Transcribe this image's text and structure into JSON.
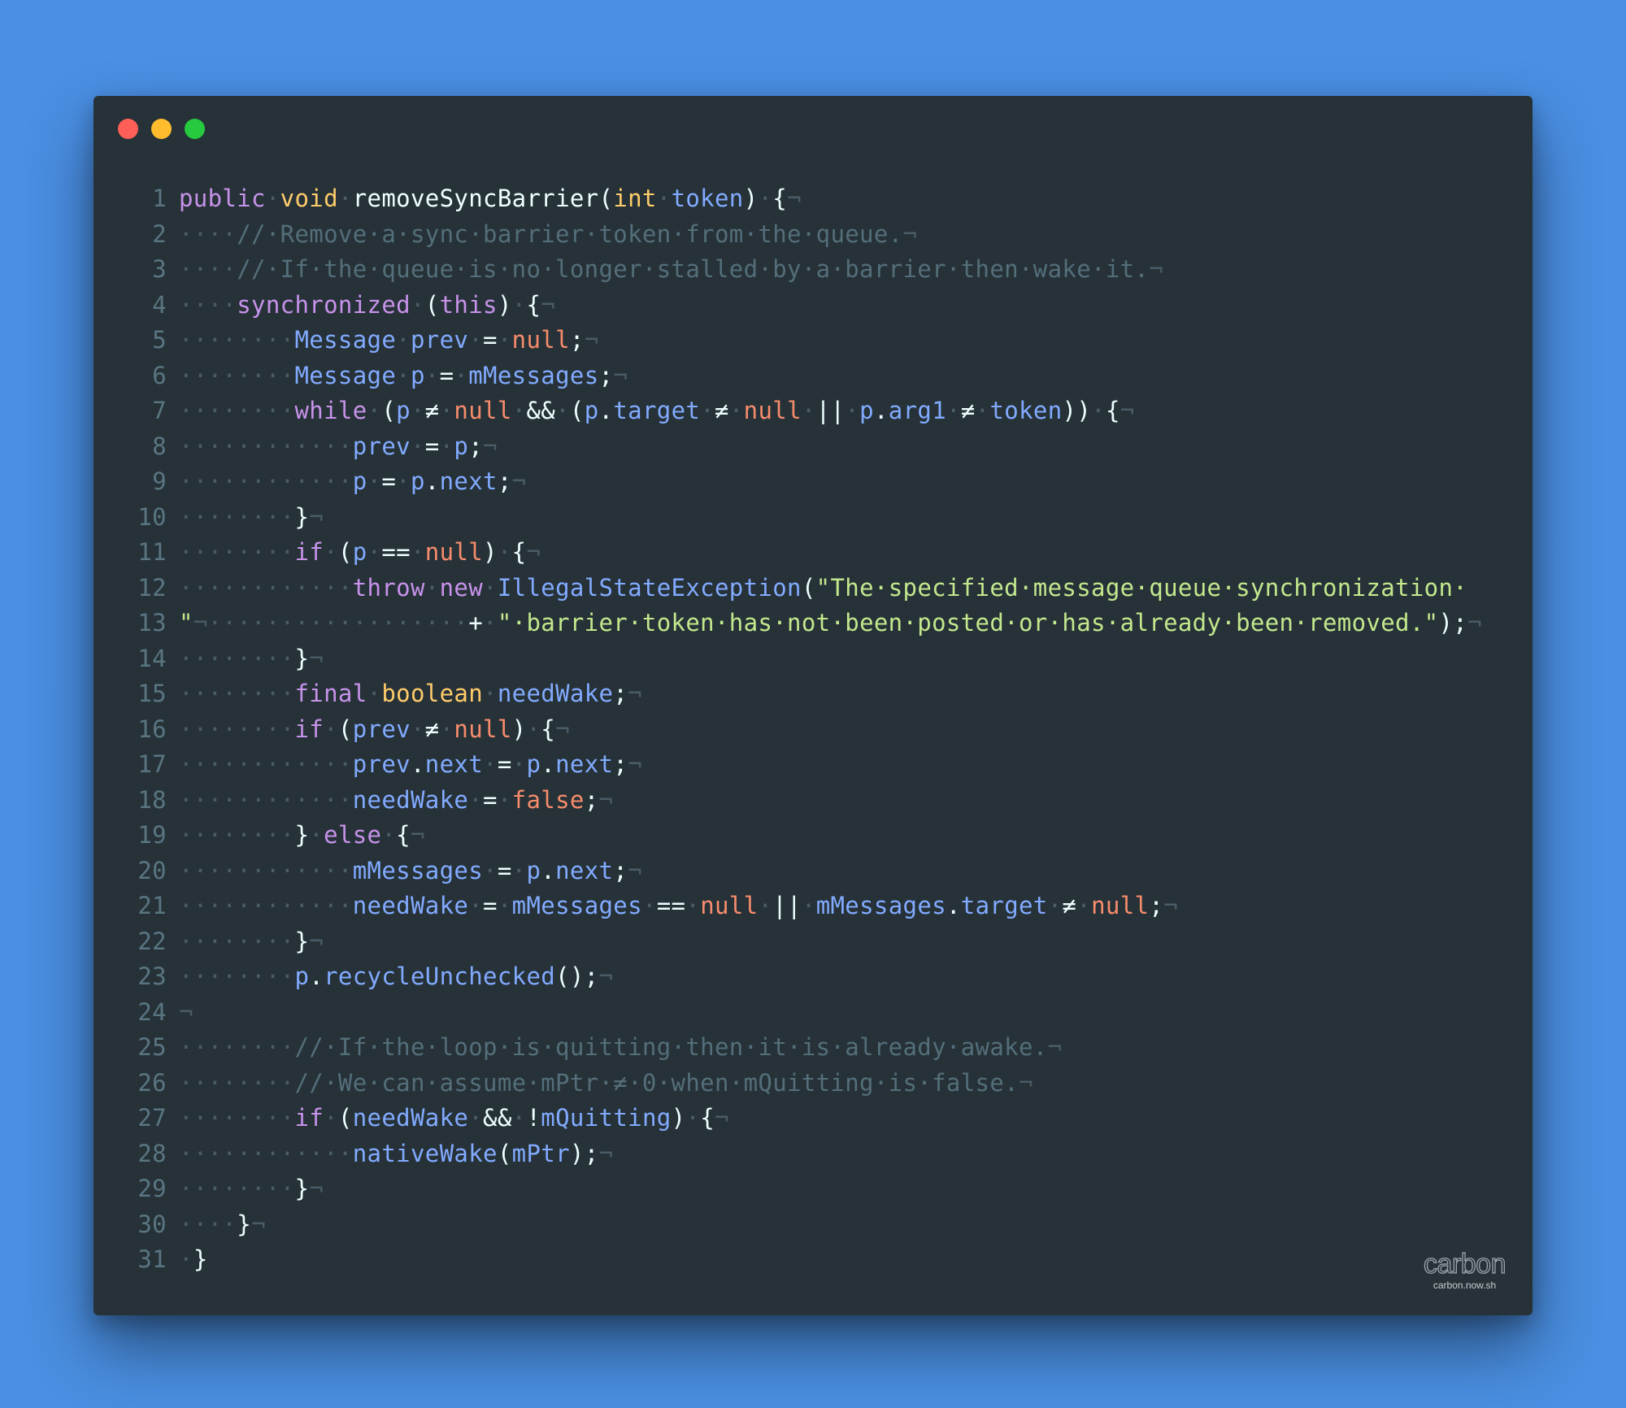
{
  "window": {
    "controls": [
      "close",
      "minimize",
      "maximize"
    ],
    "colors": {
      "background_outer": "#4a90e2",
      "editor_background": "#263238",
      "close": "#ff5f56",
      "minimize": "#ffbd2e",
      "maximize": "#27c93f"
    }
  },
  "watermark": {
    "word": "carbon",
    "url": "carbon.now.sh"
  },
  "code": {
    "language": "java",
    "lines": [
      {
        "n": "1",
        "tokens": [
          [
            "kw",
            "public"
          ],
          [
            "ws",
            "·"
          ],
          [
            "ty",
            "void"
          ],
          [
            "ws",
            "·"
          ],
          [
            "fn",
            "removeSyncBarrier("
          ],
          [
            "ty",
            "int"
          ],
          [
            "ws",
            "·"
          ],
          [
            "id",
            "token"
          ],
          [
            "pu",
            ")"
          ],
          [
            "ws",
            "·"
          ],
          [
            "pu",
            "{"
          ],
          [
            "ws",
            "¬"
          ]
        ]
      },
      {
        "n": "2",
        "tokens": [
          [
            "ws",
            "····"
          ],
          [
            "cm",
            "//·Remove·a·sync·barrier·token·from·the·queue."
          ],
          [
            "ws",
            "¬"
          ]
        ]
      },
      {
        "n": "3",
        "tokens": [
          [
            "ws",
            "····"
          ],
          [
            "cm",
            "//·If·the·queue·is·no·longer·stalled·by·a·barrier·then·wake·it."
          ],
          [
            "ws",
            "¬"
          ]
        ]
      },
      {
        "n": "4",
        "tokens": [
          [
            "ws",
            "····"
          ],
          [
            "kw",
            "synchronized"
          ],
          [
            "ws",
            "·"
          ],
          [
            "pu",
            "("
          ],
          [
            "kw",
            "this"
          ],
          [
            "pu",
            ")"
          ],
          [
            "ws",
            "·"
          ],
          [
            "pu",
            "{"
          ],
          [
            "ws",
            "¬"
          ]
        ]
      },
      {
        "n": "5",
        "tokens": [
          [
            "ws",
            "········"
          ],
          [
            "id",
            "Message"
          ],
          [
            "ws",
            "·"
          ],
          [
            "id",
            "prev"
          ],
          [
            "ws",
            "·"
          ],
          [
            "op",
            "="
          ],
          [
            "ws",
            "·"
          ],
          [
            "nu",
            "null"
          ],
          [
            "pu",
            ";"
          ],
          [
            "ws",
            "¬"
          ]
        ]
      },
      {
        "n": "6",
        "tokens": [
          [
            "ws",
            "········"
          ],
          [
            "id",
            "Message"
          ],
          [
            "ws",
            "·"
          ],
          [
            "id",
            "p"
          ],
          [
            "ws",
            "·"
          ],
          [
            "op",
            "="
          ],
          [
            "ws",
            "·"
          ],
          [
            "id",
            "mMessages"
          ],
          [
            "pu",
            ";"
          ],
          [
            "ws",
            "¬"
          ]
        ]
      },
      {
        "n": "7",
        "tokens": [
          [
            "ws",
            "········"
          ],
          [
            "kw",
            "while"
          ],
          [
            "ws",
            "·"
          ],
          [
            "pu",
            "("
          ],
          [
            "id",
            "p"
          ],
          [
            "ws",
            "·"
          ],
          [
            "op",
            "≠"
          ],
          [
            "ws",
            "·"
          ],
          [
            "nu",
            "null"
          ],
          [
            "ws",
            "·"
          ],
          [
            "op",
            "&&"
          ],
          [
            "ws",
            "·"
          ],
          [
            "pu",
            "("
          ],
          [
            "id",
            "p"
          ],
          [
            "pu",
            "."
          ],
          [
            "id",
            "target"
          ],
          [
            "ws",
            "·"
          ],
          [
            "op",
            "≠"
          ],
          [
            "ws",
            "·"
          ],
          [
            "nu",
            "null"
          ],
          [
            "ws",
            "·"
          ],
          [
            "op",
            "||"
          ],
          [
            "ws",
            "·"
          ],
          [
            "id",
            "p"
          ],
          [
            "pu",
            "."
          ],
          [
            "id",
            "arg1"
          ],
          [
            "ws",
            "·"
          ],
          [
            "op",
            "≠"
          ],
          [
            "ws",
            "·"
          ],
          [
            "id",
            "token"
          ],
          [
            "pu",
            "))"
          ],
          [
            "ws",
            "·"
          ],
          [
            "pu",
            "{"
          ],
          [
            "ws",
            "¬"
          ]
        ]
      },
      {
        "n": "8",
        "tokens": [
          [
            "ws",
            "············"
          ],
          [
            "id",
            "prev"
          ],
          [
            "ws",
            "·"
          ],
          [
            "op",
            "="
          ],
          [
            "ws",
            "·"
          ],
          [
            "id",
            "p"
          ],
          [
            "pu",
            ";"
          ],
          [
            "ws",
            "¬"
          ]
        ]
      },
      {
        "n": "9",
        "tokens": [
          [
            "ws",
            "············"
          ],
          [
            "id",
            "p"
          ],
          [
            "ws",
            "·"
          ],
          [
            "op",
            "="
          ],
          [
            "ws",
            "·"
          ],
          [
            "id",
            "p"
          ],
          [
            "pu",
            "."
          ],
          [
            "id",
            "next"
          ],
          [
            "pu",
            ";"
          ],
          [
            "ws",
            "¬"
          ]
        ]
      },
      {
        "n": "10",
        "tokens": [
          [
            "ws",
            "········"
          ],
          [
            "pu",
            "}"
          ],
          [
            "ws",
            "¬"
          ]
        ]
      },
      {
        "n": "11",
        "tokens": [
          [
            "ws",
            "········"
          ],
          [
            "kw",
            "if"
          ],
          [
            "ws",
            "·"
          ],
          [
            "pu",
            "("
          ],
          [
            "id",
            "p"
          ],
          [
            "ws",
            "·"
          ],
          [
            "op",
            "=="
          ],
          [
            "ws",
            "·"
          ],
          [
            "nu",
            "null"
          ],
          [
            "pu",
            ")"
          ],
          [
            "ws",
            "·"
          ],
          [
            "pu",
            "{"
          ],
          [
            "ws",
            "¬"
          ]
        ]
      },
      {
        "n": "12",
        "tokens": [
          [
            "ws",
            "············"
          ],
          [
            "kw",
            "throw"
          ],
          [
            "ws",
            "·"
          ],
          [
            "kw",
            "new"
          ],
          [
            "ws",
            "·"
          ],
          [
            "id",
            "IllegalStateException"
          ],
          [
            "pu",
            "("
          ],
          [
            "st",
            "\"The·specified·message·queue·synchronization·"
          ]
        ]
      },
      {
        "n": "13",
        "tokens": [
          [
            "st",
            "\""
          ],
          [
            "ws",
            "¬··················"
          ],
          [
            "op",
            "+"
          ],
          [
            "ws",
            "·"
          ],
          [
            "st",
            "\"·barrier·token·has·not·been·posted·or·has·already·been·removed.\""
          ],
          [
            "pu",
            ");"
          ],
          [
            "ws",
            "¬"
          ]
        ]
      },
      {
        "n": "14",
        "tokens": [
          [
            "ws",
            "········"
          ],
          [
            "pu",
            "}"
          ],
          [
            "ws",
            "¬"
          ]
        ]
      },
      {
        "n": "15",
        "tokens": [
          [
            "ws",
            "········"
          ],
          [
            "kw",
            "final"
          ],
          [
            "ws",
            "·"
          ],
          [
            "ty",
            "boolean"
          ],
          [
            "ws",
            "·"
          ],
          [
            "id",
            "needWake"
          ],
          [
            "pu",
            ";"
          ],
          [
            "ws",
            "¬"
          ]
        ]
      },
      {
        "n": "16",
        "tokens": [
          [
            "ws",
            "········"
          ],
          [
            "kw",
            "if"
          ],
          [
            "ws",
            "·"
          ],
          [
            "pu",
            "("
          ],
          [
            "id",
            "prev"
          ],
          [
            "ws",
            "·"
          ],
          [
            "op",
            "≠"
          ],
          [
            "ws",
            "·"
          ],
          [
            "nu",
            "null"
          ],
          [
            "pu",
            ")"
          ],
          [
            "ws",
            "·"
          ],
          [
            "pu",
            "{"
          ],
          [
            "ws",
            "¬"
          ]
        ]
      },
      {
        "n": "17",
        "tokens": [
          [
            "ws",
            "············"
          ],
          [
            "id",
            "prev"
          ],
          [
            "pu",
            "."
          ],
          [
            "id",
            "next"
          ],
          [
            "ws",
            "·"
          ],
          [
            "op",
            "="
          ],
          [
            "ws",
            "·"
          ],
          [
            "id",
            "p"
          ],
          [
            "pu",
            "."
          ],
          [
            "id",
            "next"
          ],
          [
            "pu",
            ";"
          ],
          [
            "ws",
            "¬"
          ]
        ]
      },
      {
        "n": "18",
        "tokens": [
          [
            "ws",
            "············"
          ],
          [
            "id",
            "needWake"
          ],
          [
            "ws",
            "·"
          ],
          [
            "op",
            "="
          ],
          [
            "ws",
            "·"
          ],
          [
            "nu",
            "false"
          ],
          [
            "pu",
            ";"
          ],
          [
            "ws",
            "¬"
          ]
        ]
      },
      {
        "n": "19",
        "tokens": [
          [
            "ws",
            "········"
          ],
          [
            "pu",
            "}"
          ],
          [
            "ws",
            "·"
          ],
          [
            "kw",
            "else"
          ],
          [
            "ws",
            "·"
          ],
          [
            "pu",
            "{"
          ],
          [
            "ws",
            "¬"
          ]
        ]
      },
      {
        "n": "20",
        "tokens": [
          [
            "ws",
            "············"
          ],
          [
            "id",
            "mMessages"
          ],
          [
            "ws",
            "·"
          ],
          [
            "op",
            "="
          ],
          [
            "ws",
            "·"
          ],
          [
            "id",
            "p"
          ],
          [
            "pu",
            "."
          ],
          [
            "id",
            "next"
          ],
          [
            "pu",
            ";"
          ],
          [
            "ws",
            "¬"
          ]
        ]
      },
      {
        "n": "21",
        "tokens": [
          [
            "ws",
            "············"
          ],
          [
            "id",
            "needWake"
          ],
          [
            "ws",
            "·"
          ],
          [
            "op",
            "="
          ],
          [
            "ws",
            "·"
          ],
          [
            "id",
            "mMessages"
          ],
          [
            "ws",
            "·"
          ],
          [
            "op",
            "=="
          ],
          [
            "ws",
            "·"
          ],
          [
            "nu",
            "null"
          ],
          [
            "ws",
            "·"
          ],
          [
            "op",
            "||"
          ],
          [
            "ws",
            "·"
          ],
          [
            "id",
            "mMessages"
          ],
          [
            "pu",
            "."
          ],
          [
            "id",
            "target"
          ],
          [
            "ws",
            "·"
          ],
          [
            "op",
            "≠"
          ],
          [
            "ws",
            "·"
          ],
          [
            "nu",
            "null"
          ],
          [
            "pu",
            ";"
          ],
          [
            "ws",
            "¬"
          ]
        ]
      },
      {
        "n": "22",
        "tokens": [
          [
            "ws",
            "········"
          ],
          [
            "pu",
            "}"
          ],
          [
            "ws",
            "¬"
          ]
        ]
      },
      {
        "n": "23",
        "tokens": [
          [
            "ws",
            "········"
          ],
          [
            "id",
            "p"
          ],
          [
            "pu",
            "."
          ],
          [
            "id",
            "recycleUnchecked"
          ],
          [
            "pu",
            "();"
          ],
          [
            "ws",
            "¬"
          ]
        ]
      },
      {
        "n": "24",
        "tokens": [
          [
            "ws",
            "¬"
          ]
        ]
      },
      {
        "n": "25",
        "tokens": [
          [
            "ws",
            "········"
          ],
          [
            "cm",
            "//·If·the·loop·is·quitting·then·it·is·already·awake."
          ],
          [
            "ws",
            "¬"
          ]
        ]
      },
      {
        "n": "26",
        "tokens": [
          [
            "ws",
            "········"
          ],
          [
            "cm",
            "//·We·can·assume·mPtr·≠·0·when·mQuitting·is·false."
          ],
          [
            "ws",
            "¬"
          ]
        ]
      },
      {
        "n": "27",
        "tokens": [
          [
            "ws",
            "········"
          ],
          [
            "kw",
            "if"
          ],
          [
            "ws",
            "·"
          ],
          [
            "pu",
            "("
          ],
          [
            "id",
            "needWake"
          ],
          [
            "ws",
            "·"
          ],
          [
            "op",
            "&&"
          ],
          [
            "ws",
            "·"
          ],
          [
            "op",
            "!"
          ],
          [
            "id",
            "mQuitting"
          ],
          [
            "pu",
            ")"
          ],
          [
            "ws",
            "·"
          ],
          [
            "pu",
            "{"
          ],
          [
            "ws",
            "¬"
          ]
        ]
      },
      {
        "n": "28",
        "tokens": [
          [
            "ws",
            "············"
          ],
          [
            "id",
            "nativeWake"
          ],
          [
            "pu",
            "("
          ],
          [
            "id",
            "mPtr"
          ],
          [
            "pu",
            ");"
          ],
          [
            "ws",
            "¬"
          ]
        ]
      },
      {
        "n": "29",
        "tokens": [
          [
            "ws",
            "········"
          ],
          [
            "pu",
            "}"
          ],
          [
            "ws",
            "¬"
          ]
        ]
      },
      {
        "n": "30",
        "tokens": [
          [
            "ws",
            "····"
          ],
          [
            "pu",
            "}"
          ],
          [
            "ws",
            "¬"
          ]
        ]
      },
      {
        "n": "31",
        "tokens": [
          [
            "ws",
            "·"
          ],
          [
            "pu",
            "}"
          ]
        ]
      }
    ]
  }
}
